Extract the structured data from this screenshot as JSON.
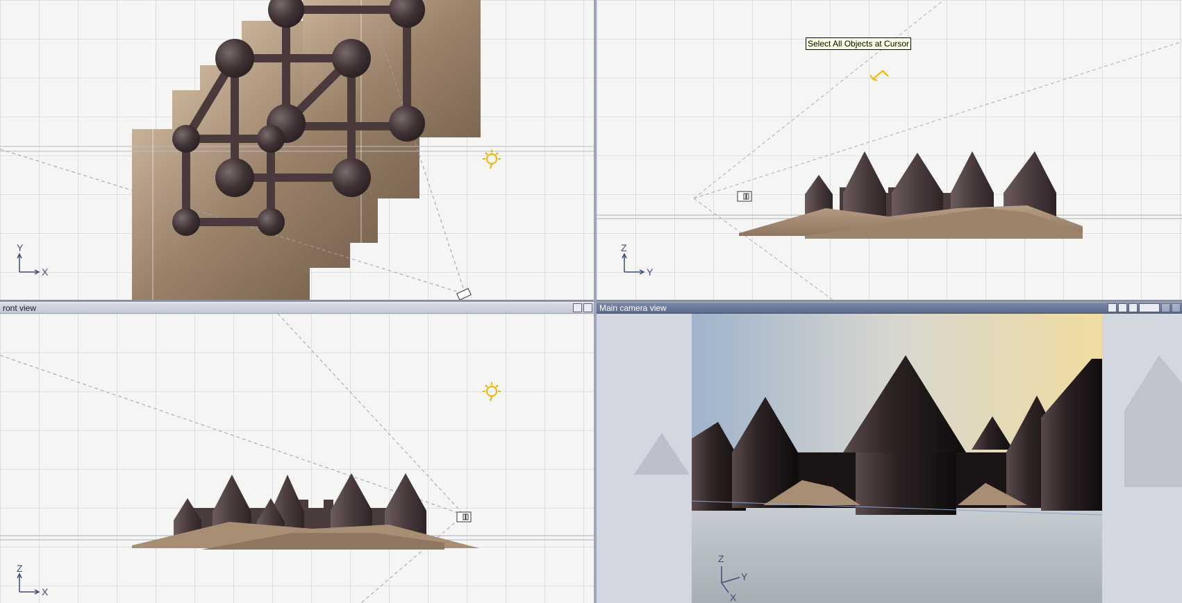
{
  "tooltip": {
    "text": "Select All Objects at Cursor"
  },
  "viewports": {
    "top_left": {
      "axis_v": "Y",
      "axis_h": "X"
    },
    "top_right": {
      "axis_v": "Z",
      "axis_h": "Y"
    },
    "front": {
      "title": "ront view",
      "axis_v": "Z",
      "axis_h": "X"
    },
    "camera": {
      "title": "Main camera view",
      "axis_v": "Z",
      "axis_h": "Y",
      "axis_d": "X"
    }
  },
  "colors": {
    "sand": "#a88f74",
    "tower": "#4d3f40",
    "paper": "#f5f5f3",
    "title_active": "#5c6a8e",
    "title_inactive": "#c3c8d6",
    "light_icon": "#f0b400"
  },
  "icons": {
    "light": "sun-icon",
    "camera": "camera-icon",
    "spotlight": "spotlight-icon"
  }
}
